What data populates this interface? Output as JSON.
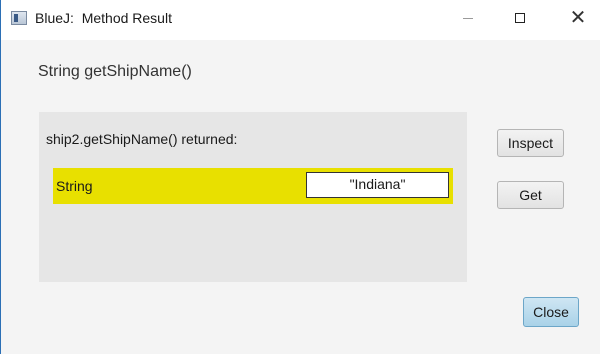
{
  "window": {
    "title": "BlueJ:  Method Result",
    "controls": {
      "minimize": "minimize-icon",
      "maximize": "maximize-icon",
      "close": "close-icon",
      "close_glyph": "✕"
    }
  },
  "method": {
    "signature": "String getShipName()"
  },
  "result": {
    "returned_label": "ship2.getShipName() returned:",
    "type": "String",
    "value": "\"Indiana\"",
    "highlight_color": "#e8e000"
  },
  "buttons": {
    "inspect": "Inspect",
    "get": "Get",
    "close": "Close"
  }
}
